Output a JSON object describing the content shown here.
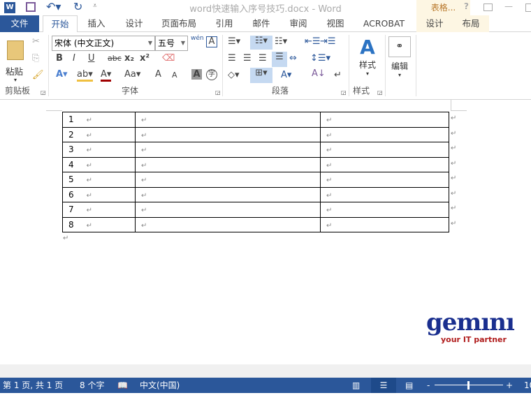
{
  "titlebar": {
    "title": "word快速输入序号技巧.docx - Word",
    "context_tab": "表格...",
    "help": "?",
    "minimize": "—"
  },
  "tabs": {
    "file": "文件",
    "items": [
      "开始",
      "插入",
      "设计",
      "页面布局",
      "引用",
      "邮件",
      "审阅",
      "视图",
      "ACROBAT"
    ],
    "context": [
      "设计",
      "布局"
    ]
  },
  "ribbon": {
    "clipboard": {
      "paste": "粘贴",
      "label": "剪贴板"
    },
    "font": {
      "font_name": "宋体 (中文正文)",
      "font_size": "五号",
      "label": "字体",
      "bold": "B",
      "italic": "I",
      "underline": "U",
      "strike": "abc",
      "sub": "x₂",
      "sup": "x²",
      "change_case": "Aa",
      "grow": "A",
      "shrink": "A",
      "shade": "A",
      "phonetic": "字",
      "pinyin": "wén"
    },
    "paragraph": {
      "label": "段落"
    },
    "styles": {
      "button": "样式",
      "label": "样式"
    },
    "editing": {
      "button": "编辑"
    }
  },
  "document": {
    "rows": [
      [
        "1",
        "",
        ""
      ],
      [
        "2",
        "",
        ""
      ],
      [
        "3",
        "",
        ""
      ],
      [
        "4",
        "",
        ""
      ],
      [
        "5",
        "",
        ""
      ],
      [
        "6",
        "",
        ""
      ],
      [
        "7",
        "",
        ""
      ],
      [
        "8",
        "",
        ""
      ]
    ],
    "para_mark": "↵"
  },
  "watermark": {
    "logo": "gemini",
    "tagline": "your IT partner"
  },
  "status": {
    "page": "第 1 页, 共 1 页",
    "words": "8 个字",
    "language": "中文(中国)",
    "zoom": "10"
  },
  "colors": {
    "accent": "#2b579a",
    "context": "#fdf6e3",
    "logo": "#1a2f8f",
    "tagline": "#b01c1c"
  }
}
